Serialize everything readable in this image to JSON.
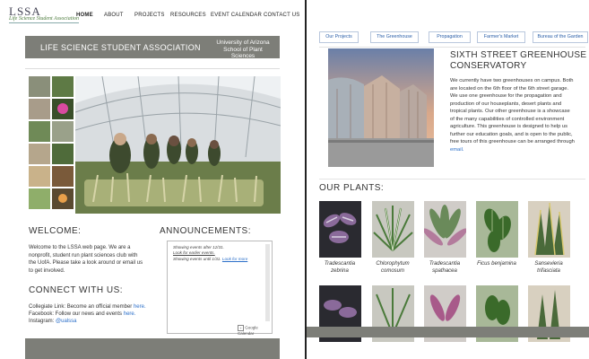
{
  "left": {
    "logo": {
      "letters": "LSSA",
      "subtitle": "Life Science Student Association"
    },
    "nav": [
      {
        "label": "HOME",
        "active": true
      },
      {
        "label": "ABOUT"
      },
      {
        "label": "PROJECTS"
      },
      {
        "label": "RESOURCES"
      },
      {
        "label": "EVENT CALENDAR"
      },
      {
        "label": "CONTACT US"
      }
    ],
    "banner": {
      "title": "LIFE SCIENCE STUDENT ASSOCIATION",
      "right_line1": "University of Arizona",
      "right_line2": "School of Plant Sciences"
    },
    "welcome": {
      "heading": "WELCOME:",
      "text": "Welcome to the LSSA web page. We are a nonprofit, student run plant sciences club with the UofA. Please take a look around or email us to get involved."
    },
    "connect": {
      "heading": "CONNECT WITH US:",
      "collegiate_text": "Collegiate Link: Become an official member ",
      "collegiate_link": "here.",
      "facebook_text": "Facebook: Follow our news and events ",
      "facebook_link": "here.",
      "instagram_text": "Instagram: ",
      "instagram_link": "@ualssa"
    },
    "announcements": {
      "heading": "ANNOUNCEMENTS:",
      "line1": "Showing events after 12/31.",
      "line2": "Look for earlier events.",
      "line3": "Showing events until 1/31.",
      "line4": "Look for more",
      "footer": "Google Calendar"
    }
  },
  "right": {
    "tabs": [
      "Our Projects",
      "The Greenhouse",
      "Propagation",
      "Farmer's Market",
      "Bureau of the Garden"
    ],
    "greenhouse": {
      "title_line1": "SIXTH STREET GREENHOUSE",
      "title_line2": "CONSERVATORY",
      "text": "We currently have two greenhouses on campus. Both are located on the 6th floor of the 6th street garage. We use one greenhouse for the propagation and production of our houseplants, desert plants and tropical plants. Our other greenhouse is a showcase of the many capabilities of controlled environment agriculture. This greenhouse is designed to help us further our education goals, and is open to the public, free tours of this greenhouse can be arranged through ",
      "link": "email."
    },
    "plants": {
      "heading": "OUR PLANTS:",
      "items": [
        {
          "line1": "Tradescantia",
          "line2": "zebrina"
        },
        {
          "line1": "Chlorophytum",
          "line2": "comosum"
        },
        {
          "line1": "Tradescantia",
          "line2": "spathacea"
        },
        {
          "line1": "Ficus benjamina",
          "line2": ""
        },
        {
          "line1": "Sansevieria",
          "line2": "trifasciata"
        }
      ]
    }
  },
  "colors": {
    "banner": "#7d7e78",
    "link": "#2b6fc9",
    "tab_border": "#b9c7dd"
  }
}
